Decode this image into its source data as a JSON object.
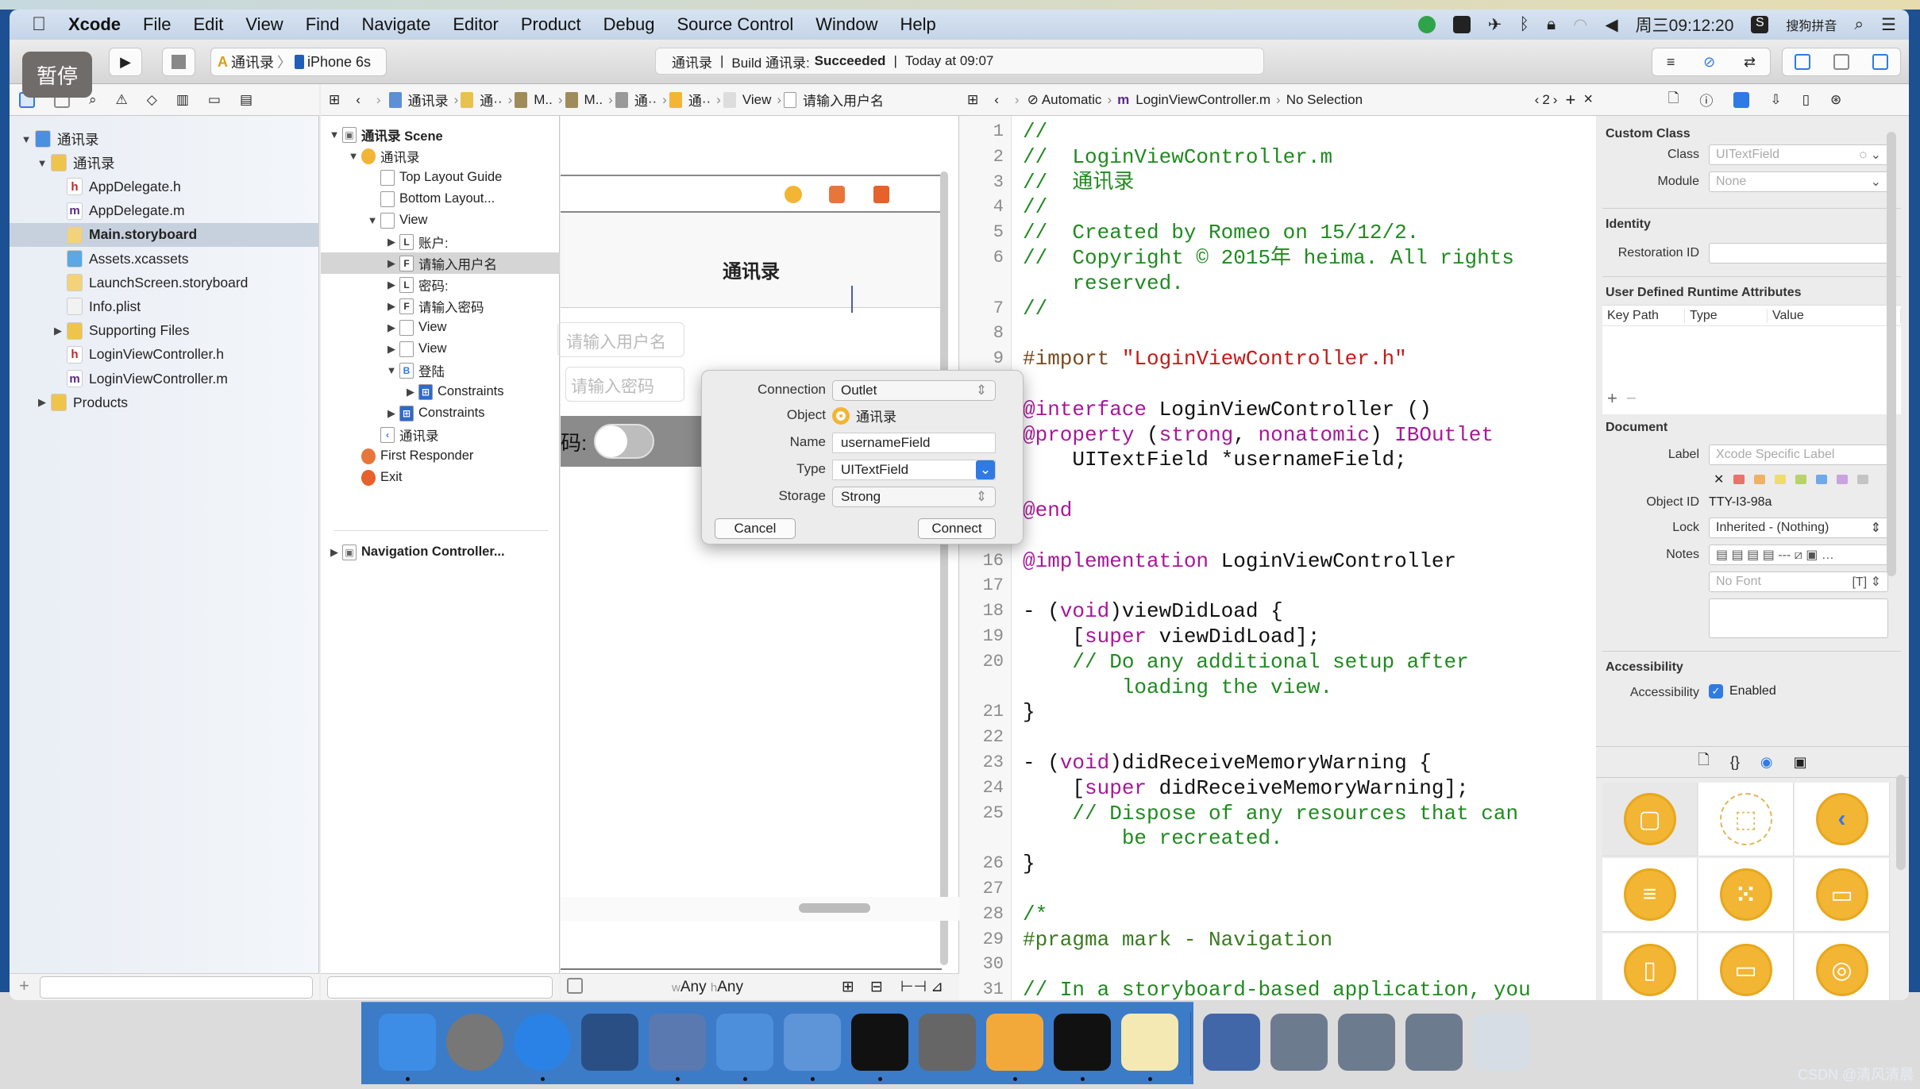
{
  "menubar": {
    "app": "Xcode",
    "items": [
      "File",
      "Edit",
      "View",
      "Find",
      "Navigate",
      "Editor",
      "Product",
      "Debug",
      "Source Control",
      "Window",
      "Help"
    ],
    "clock": "周三09:12:20",
    "input_method": "搜狗拼音"
  },
  "toolbar": {
    "pause_overlay": "暂停",
    "scheme": "通讯录",
    "device": "iPhone 6s",
    "activity": {
      "project": "通讯录",
      "build_prefix": "Build 通讯录:",
      "build_status": "Succeeded",
      "time": "Today at 09:07"
    }
  },
  "canvas_jumpbar": [
    "通讯录",
    "通··",
    "M..",
    "M..",
    "通··",
    "通··",
    "View",
    "请输入用户名"
  ],
  "editor_jumpbar": {
    "mode": "Automatic",
    "file": "LoginViewController.m",
    "selection": "No Selection",
    "counter": "2"
  },
  "navigator": {
    "items": [
      {
        "label": "通讯录",
        "level": 0,
        "toggle": "open",
        "icon": "project",
        "selected": false
      },
      {
        "label": "通讯录",
        "level": 1,
        "toggle": "open",
        "icon": "folder",
        "selected": false
      },
      {
        "label": "AppDelegate.h",
        "level": 2,
        "toggle": "none",
        "icon": "h",
        "selected": false
      },
      {
        "label": "AppDelegate.m",
        "level": 2,
        "toggle": "none",
        "icon": "m",
        "selected": false
      },
      {
        "label": "Main.storyboard",
        "level": 2,
        "toggle": "none",
        "icon": "storyboard",
        "selected": true
      },
      {
        "label": "Assets.xcassets",
        "level": 2,
        "toggle": "none",
        "icon": "assets",
        "selected": false
      },
      {
        "label": "LaunchScreen.storyboard",
        "level": 2,
        "toggle": "none",
        "icon": "storyboard",
        "selected": false
      },
      {
        "label": "Info.plist",
        "level": 2,
        "toggle": "none",
        "icon": "plist",
        "selected": false
      },
      {
        "label": "Supporting Files",
        "level": 2,
        "toggle": "closed",
        "icon": "folder",
        "selected": false
      },
      {
        "label": "LoginViewController.h",
        "level": 2,
        "toggle": "none",
        "icon": "h",
        "selected": false
      },
      {
        "label": "LoginViewController.m",
        "level": 2,
        "toggle": "none",
        "icon": "m",
        "selected": false
      },
      {
        "label": "Products",
        "level": 1,
        "toggle": "closed",
        "icon": "folder",
        "selected": false
      }
    ]
  },
  "outline": {
    "items": [
      {
        "label": "通讯录 Scene",
        "level": 0,
        "toggle": "open",
        "icon": "scene",
        "bold": true
      },
      {
        "label": "通讯录",
        "level": 1,
        "toggle": "open",
        "icon": "vc"
      },
      {
        "label": "Top Layout Guide",
        "level": 2,
        "toggle": "none",
        "icon": "guide"
      },
      {
        "label": "Bottom Layout...",
        "level": 2,
        "toggle": "none",
        "icon": "guide"
      },
      {
        "label": "View",
        "level": 2,
        "toggle": "open",
        "icon": "view"
      },
      {
        "label": "账户:",
        "level": 3,
        "toggle": "closed",
        "icon": "L"
      },
      {
        "label": "请输入用户名",
        "level": 3,
        "toggle": "closed",
        "icon": "F",
        "selected": true
      },
      {
        "label": "密码:",
        "level": 3,
        "toggle": "closed",
        "icon": "L"
      },
      {
        "label": "请输入密码",
        "level": 3,
        "toggle": "closed",
        "icon": "F"
      },
      {
        "label": "View",
        "level": 3,
        "toggle": "closed",
        "icon": "view"
      },
      {
        "label": "View",
        "level": 3,
        "toggle": "closed",
        "icon": "view"
      },
      {
        "label": "登陆",
        "level": 3,
        "toggle": "open",
        "icon": "B"
      },
      {
        "label": "Constraints",
        "level": 4,
        "toggle": "closed",
        "icon": "constraints"
      },
      {
        "label": "Constraints",
        "level": 3,
        "toggle": "closed",
        "icon": "constraints"
      },
      {
        "label": "通讯录",
        "level": 2,
        "toggle": "none",
        "icon": "back"
      },
      {
        "label": "First Responder",
        "level": 1,
        "toggle": "none",
        "icon": "responder"
      },
      {
        "label": "Exit",
        "level": 1,
        "toggle": "none",
        "icon": "exit"
      },
      {
        "label": "Navigation Controller...",
        "level": 0,
        "toggle": "closed",
        "icon": "scene",
        "bold": true
      }
    ]
  },
  "canvas": {
    "nav_title": "通讯录",
    "username_placeholder": "请输入用户名",
    "password_placeholder": "请输入密码",
    "password_label_fragment": "码:",
    "login_button": "登陆",
    "size_class_w": "Any",
    "size_class_h": "Any",
    "switch_on": false
  },
  "connection_popover": {
    "connection_label": "Connection",
    "connection_value": "Outlet",
    "object_label": "Object",
    "object_value": "通讯录",
    "name_label": "Name",
    "name_value": "usernameField",
    "type_label": "Type",
    "type_value": "UITextField",
    "storage_label": "Storage",
    "storage_value": "Strong",
    "cancel": "Cancel",
    "connect": "Connect"
  },
  "code": {
    "rows": [
      {
        "n": "1",
        "tokens": [
          [
            "comment",
            "//"
          ]
        ]
      },
      {
        "n": "2",
        "tokens": [
          [
            "comment",
            "//  LoginViewController.m"
          ]
        ]
      },
      {
        "n": "3",
        "tokens": [
          [
            "comment",
            "//  通讯录"
          ]
        ]
      },
      {
        "n": "4",
        "tokens": [
          [
            "comment",
            "//"
          ]
        ]
      },
      {
        "n": "5",
        "tokens": [
          [
            "comment",
            "//  Created by Romeo on 15/12/2."
          ]
        ]
      },
      {
        "n": "6",
        "tokens": [
          [
            "comment",
            "//  Copyright © 2015年 heima. All rights"
          ]
        ]
      },
      {
        "n": "",
        "tokens": [
          [
            "comment",
            "    reserved."
          ]
        ]
      },
      {
        "n": "7",
        "tokens": [
          [
            "comment",
            "//"
          ]
        ]
      },
      {
        "n": "8",
        "tokens": []
      },
      {
        "n": "9",
        "tokens": [
          [
            "preproc",
            "#import "
          ],
          [
            "string",
            "\"LoginViewController.h\""
          ]
        ]
      },
      {
        "n": "10",
        "tokens": []
      },
      {
        "n": "11",
        "tokens": [
          [
            "keyword",
            "@interface"
          ],
          [
            "plain",
            " LoginViewController ()"
          ]
        ]
      },
      {
        "n": "12",
        "tokens": [
          [
            "keyword",
            "@property"
          ],
          [
            "plain",
            " ("
          ],
          [
            "keyword",
            "strong"
          ],
          [
            "plain",
            ", "
          ],
          [
            "keyword",
            "nonatomic"
          ],
          [
            "plain",
            ") "
          ],
          [
            "keyword",
            "IBOutlet"
          ]
        ]
      },
      {
        "n": "",
        "tokens": [
          [
            "plain",
            "    UITextField *usernameField;"
          ]
        ]
      },
      {
        "n": "13",
        "tokens": []
      },
      {
        "n": "14",
        "tokens": [
          [
            "keyword",
            "@end"
          ]
        ]
      },
      {
        "n": "15",
        "tokens": []
      },
      {
        "n": "16",
        "tokens": [
          [
            "keyword",
            "@implementation"
          ],
          [
            "plain",
            " LoginViewController"
          ]
        ]
      },
      {
        "n": "17",
        "tokens": []
      },
      {
        "n": "18",
        "tokens": [
          [
            "plain",
            "- ("
          ],
          [
            "keyword",
            "void"
          ],
          [
            "plain",
            ")viewDidLoad {"
          ]
        ]
      },
      {
        "n": "19",
        "tokens": [
          [
            "plain",
            "    ["
          ],
          [
            "keyword",
            "super"
          ],
          [
            "plain",
            " viewDidLoad];"
          ]
        ]
      },
      {
        "n": "20",
        "tokens": [
          [
            "comment",
            "    // Do any additional setup after"
          ]
        ]
      },
      {
        "n": "",
        "tokens": [
          [
            "comment",
            "        loading the view."
          ]
        ]
      },
      {
        "n": "21",
        "tokens": [
          [
            "plain",
            "}"
          ]
        ]
      },
      {
        "n": "22",
        "tokens": []
      },
      {
        "n": "23",
        "tokens": [
          [
            "plain",
            "- ("
          ],
          [
            "keyword",
            "void"
          ],
          [
            "plain",
            ")didReceiveMemoryWarning {"
          ]
        ]
      },
      {
        "n": "24",
        "tokens": [
          [
            "plain",
            "    ["
          ],
          [
            "keyword",
            "super"
          ],
          [
            "plain",
            " didReceiveMemoryWarning];"
          ]
        ]
      },
      {
        "n": "25",
        "tokens": [
          [
            "comment",
            "    // Dispose of any resources that can"
          ]
        ]
      },
      {
        "n": "",
        "tokens": [
          [
            "comment",
            "        be recreated."
          ]
        ]
      },
      {
        "n": "26",
        "tokens": [
          [
            "plain",
            "}"
          ]
        ]
      },
      {
        "n": "27",
        "tokens": []
      },
      {
        "n": "28",
        "tokens": [
          [
            "comment",
            "/*"
          ]
        ]
      },
      {
        "n": "29",
        "tokens": [
          [
            "pragma",
            "#pragma mark - Navigation"
          ]
        ]
      },
      {
        "n": "30",
        "tokens": []
      },
      {
        "n": "31",
        "tokens": [
          [
            "comment",
            "// In a storyboard-based application, you"
          ]
        ]
      }
    ]
  },
  "inspector": {
    "custom_class": {
      "title": "Custom Class",
      "class_label": "Class",
      "class_placeholder": "UITextField",
      "module_label": "Module",
      "module_placeholder": "None"
    },
    "identity": {
      "title": "Identity",
      "restoration_label": "Restoration ID",
      "restoration_value": ""
    },
    "runtime_attrs": {
      "title": "User Defined Runtime Attributes",
      "columns": [
        "Key Path",
        "Type",
        "Value"
      ]
    },
    "document": {
      "title": "Document",
      "label_label": "Label",
      "label_placeholder": "Xcode Specific Label",
      "object_id_label": "Object ID",
      "object_id": "TTY-I3-98a",
      "lock_label": "Lock",
      "lock_value": "Inherited - (Nothing)",
      "notes_label": "Notes",
      "font_placeholder": "No Font"
    },
    "label_colors": [
      "#e8736b",
      "#f0b166",
      "#eedc6e",
      "#b7d36a",
      "#6fa9ea",
      "#c9a3e0",
      "#c4c4c4"
    ],
    "accessibility": {
      "title": "Accessibility",
      "label": "Accessibility",
      "enabled_label": "Enabled",
      "enabled": true
    }
  },
  "library": {
    "items": [
      "view-controller",
      "storyboard-reference",
      "navigation-controller",
      "table-view-controller",
      "collection-view-controller",
      "tab-bar-controller",
      "page-view-controller",
      "glkit-view-controller",
      "avkit-player-view-controller"
    ]
  },
  "dock": {
    "apps": [
      "finder",
      "launchpad",
      "safari",
      "mouse",
      "photo-booth",
      "xcode",
      "simulator",
      "terminal",
      "system-preferences",
      "sketch",
      "console",
      "stickies",
      "media-player",
      "screenshot",
      "screenshot",
      "screenshot",
      "trash"
    ]
  },
  "watermark": "CSDN @清风清晨",
  "colors": {
    "accent": "#2f7ae5",
    "selection": "#c7d1de",
    "library_icon": "#f2b534",
    "dock": "#3c7bc7"
  }
}
